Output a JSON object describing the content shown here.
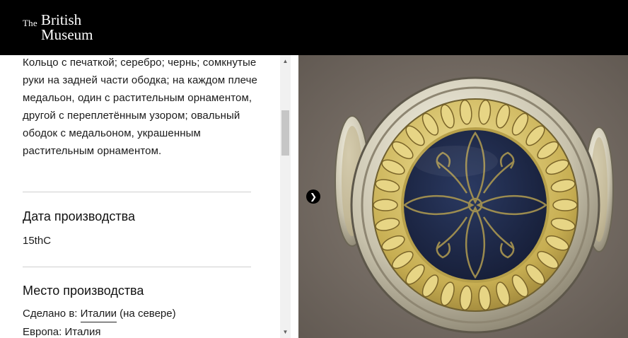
{
  "header": {
    "logo_the": "The",
    "logo_british": "British",
    "logo_museum": "Museum"
  },
  "object": {
    "description": "Кольцо с печаткой; серебро; чернь; сомкнутые руки на задней части ободка; на каждом плече медальон, один с растительным орнаментом, другой с переплетённым узором; овальный ободок с медальоном, украшенным растительным орнаментом."
  },
  "production_date": {
    "title": "Дата производства",
    "value": "15thC"
  },
  "production_place": {
    "title": "Место производства",
    "made_in_prefix": "Сделано в:",
    "made_in_link": "Италии",
    "made_in_suffix": "(на севере)",
    "region": "Европа: Италия"
  },
  "image": {
    "alt": "Silver ring with niello oval bezel"
  },
  "icons": {
    "scroll_up": "scroll-up-arrow-icon",
    "scroll_down": "scroll-down-arrow-icon",
    "next": "chevron-right-icon"
  },
  "colors": {
    "header_bg": "#000000",
    "niello": "#1e2a4a",
    "gilt": "#c9b45a",
    "silver": "#d8d4c2"
  }
}
